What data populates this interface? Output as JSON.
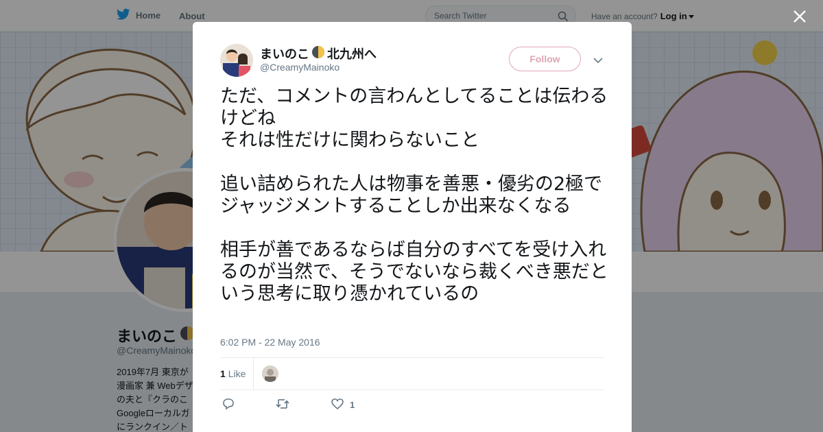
{
  "nav": {
    "home_label": "Home",
    "about_label": "About",
    "search_placeholder": "Search Twitter",
    "account_prompt": "Have an account?",
    "login_label": "Log in"
  },
  "profile": {
    "name": "まいのこ",
    "handle": "@CreamyMainoko",
    "bio": "2019年7月 東京が\n漫画家 兼 Webデザ\nの夫と『クラのこ\nGoogleローカルガ\nにランクイン／ト"
  },
  "tweet": {
    "author_name": "まいのこ",
    "author_name_suffix": "北九州へ",
    "author_handle": "@CreamyMainoko",
    "follow_label": "Follow",
    "text": "ただ、コメントの言わんとしてることは伝わるけどね\nそれは性だけに関わらないこと\n\n追い詰められた人は物事を善悪・優劣の2極でジャッジメントすることしか出来なくなる\n\n相手が善であるならば自分のすべてを受け入れるのが当然で、そうでないなら裁くべき悪だという思考に取り憑かれているの",
    "timestamp": "6:02 PM - 22 May 2016",
    "like_count": "1",
    "like_label": "Like",
    "action_like_count": "1"
  },
  "colors": {
    "twitter_blue": "#1da1f2",
    "follow_pink": "#e0a6b5",
    "muted_text": "#657786"
  },
  "icons": [
    "twitter-bird-icon",
    "search-icon",
    "close-icon",
    "chevron-down-icon",
    "reply-icon",
    "retweet-icon",
    "heart-icon",
    "moon-icon"
  ]
}
